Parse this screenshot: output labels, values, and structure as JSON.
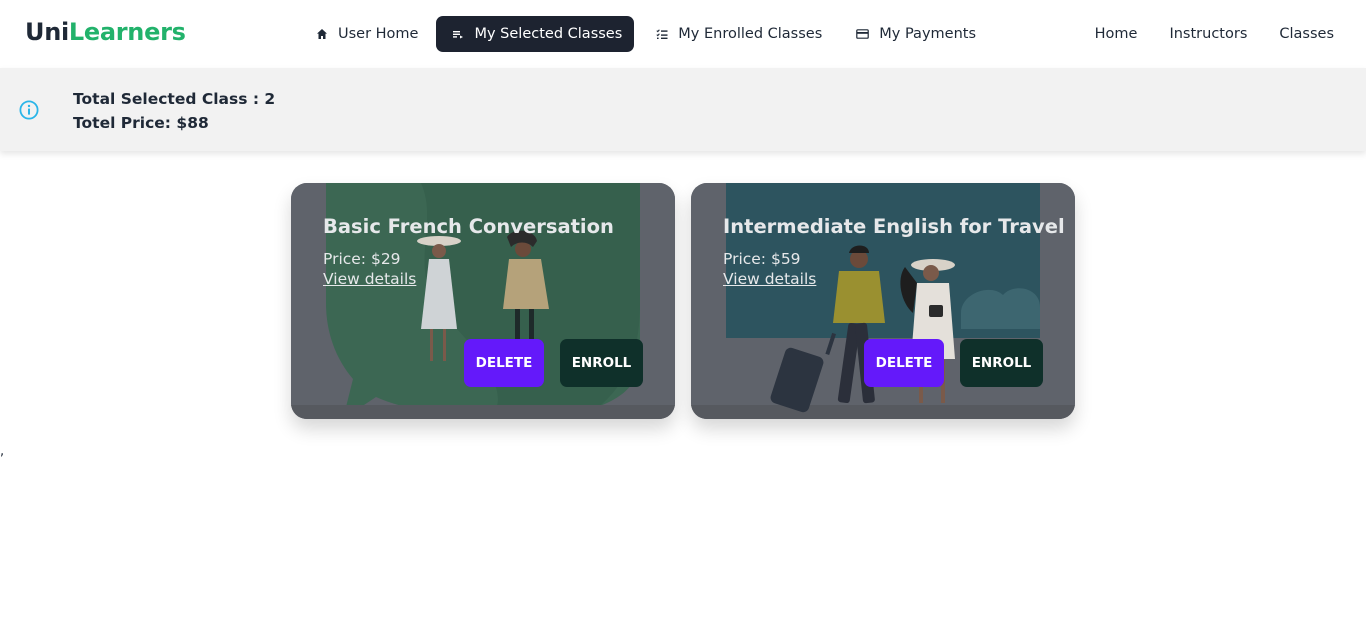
{
  "brand": {
    "part1": "Uni",
    "part2": "Learners",
    "accent": "#22b26b"
  },
  "dashboard_tabs": [
    {
      "label": "User Home",
      "icon": "home-icon",
      "active": false
    },
    {
      "label": "My Selected Classes",
      "icon": "list-bullet-icon",
      "active": true
    },
    {
      "label": "My Enrolled Classes",
      "icon": "checklist-icon",
      "active": false
    },
    {
      "label": "My Payments",
      "icon": "credit-card-icon",
      "active": false
    }
  ],
  "site_links": [
    "Home",
    "Instructors",
    "Classes"
  ],
  "summary": {
    "icon": "info-circle-icon",
    "total_line": "Total Selected Class : 2",
    "price_line": "Totel Price: $88"
  },
  "classes": [
    {
      "title": "Basic French Conversation",
      "price": "Price: $29",
      "details_label": "View details",
      "delete_label": "DELETE",
      "enroll_label": "ENROLL"
    },
    {
      "title": "Intermediate English for Travel",
      "price": "Price: $59",
      "details_label": "View details",
      "delete_label": "DELETE",
      "enroll_label": "ENROLL"
    }
  ],
  "stray_mark": ",",
  "colors": {
    "active_tab_bg": "#1d2330",
    "delete_button": "#6419fa",
    "enroll_button": "#0f302a",
    "card_overlay": "#5f636b",
    "info_icon": "#2bb5e8"
  }
}
